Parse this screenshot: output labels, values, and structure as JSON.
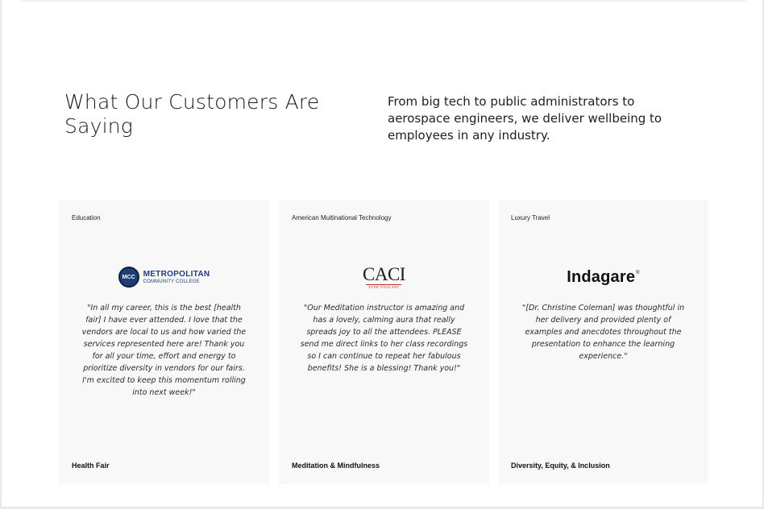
{
  "section": {
    "title": "What Our Customers Are Saying",
    "intro": "From big tech to public administrators to aerospace engineers, we deliver wellbeing to employees in any industry."
  },
  "cards": [
    {
      "industry": "Education",
      "logo": {
        "circle_text": "MCC",
        "name": "METROPOLITAN",
        "subtitle": "COMMUNITY COLLEGE"
      },
      "quote": "\"In all my career, this is the best [health fair] I have ever attended. I love that the vendors are local to us and how varied the services represented here are! Thank you for all your time, effort and energy to prioritize diversity in vendors for our fairs. I'm excited to keep this momentum rolling into next week!\"",
      "service": "Health Fair"
    },
    {
      "industry": "American Multinational Technology",
      "logo": {
        "name": "CACI",
        "tagline": "EVER VIGILANT"
      },
      "quote": "\"Our Meditation instructor is amazing and has a lovely, calming aura that really spreads joy to all the attendees. PLEASE send me direct links to her class recordings so I can continue to repeat her fabulous benefits! She is a blessing! Thank you!\"",
      "service": "Meditation & Mindfulness"
    },
    {
      "industry": "Luxury Travel",
      "logo": {
        "name": "Indagare",
        "mark": "®"
      },
      "quote": "\"[Dr. Christine Coleman] was thoughtful in her delivery and provided plenty of examples and anecdotes throughout the presentation to enhance the learning experience.\"",
      "service": "Diversity, Equity, & Inclusion"
    }
  ],
  "colors": {
    "mcc_blue": "#1f3e78",
    "caci_red": "#c0272d",
    "card_bg": "#f8f8f8"
  }
}
